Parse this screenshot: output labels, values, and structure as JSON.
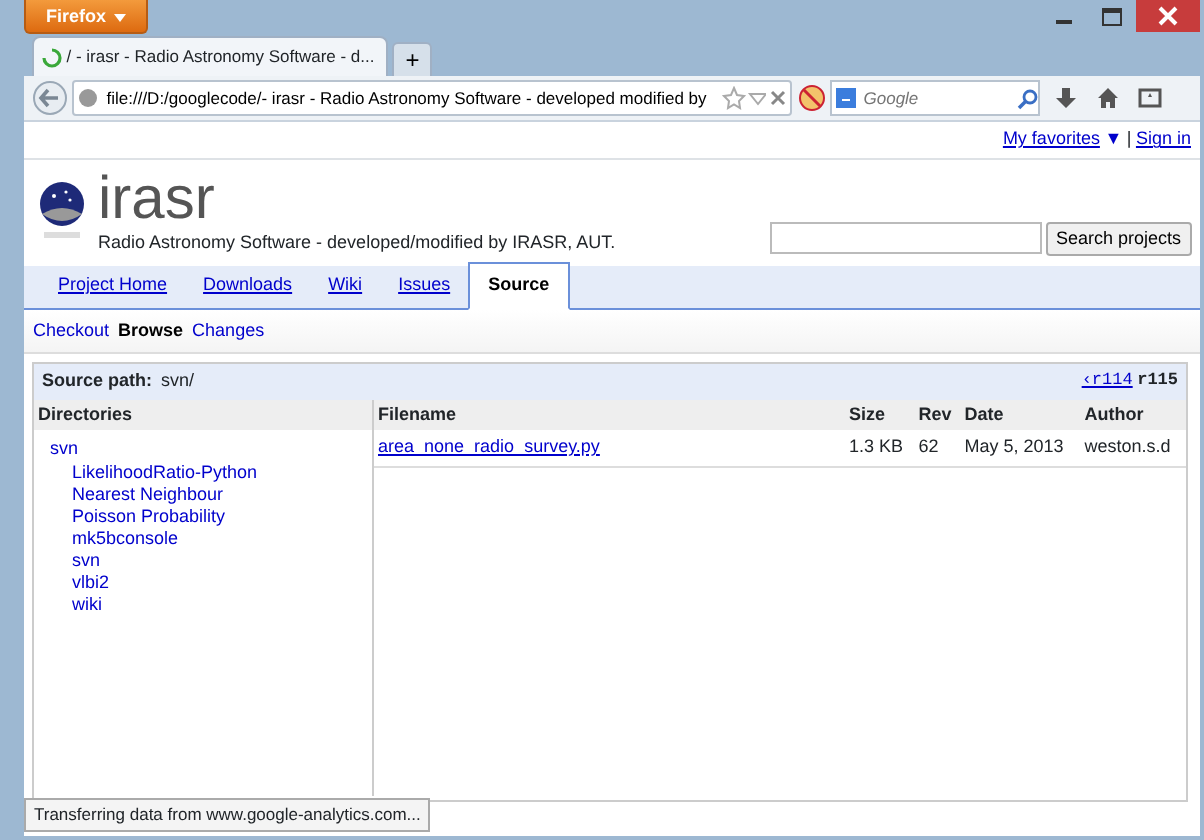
{
  "browser": {
    "menu_button": "Firefox",
    "tabs": [
      {
        "title": "/ - irasr - Radio Astronomy Software - d...",
        "selected": true,
        "loading": true
      }
    ],
    "new_tab": "+",
    "url": "file:///D:/googlecode/- irasr - Radio Astronomy Software - developed modified by",
    "search_placeholder": "Google",
    "status": "Transferring data from www.google-analytics.com..."
  },
  "user_bar": {
    "favorites": "My favorites",
    "caret": "▼",
    "separator": "|",
    "sign_in": "Sign in"
  },
  "project": {
    "name": "irasr",
    "summary": "Radio Astronomy Software - developed/modified by IRASR, AUT.",
    "search_button": "Search projects"
  },
  "main_tabs": [
    {
      "label": "Project Home",
      "selected": false
    },
    {
      "label": "Downloads",
      "selected": false
    },
    {
      "label": "Wiki",
      "selected": false
    },
    {
      "label": "Issues",
      "selected": false
    },
    {
      "label": "Source",
      "selected": true
    }
  ],
  "sub_tabs": [
    {
      "label": "Checkout",
      "selected": false
    },
    {
      "label": "Browse",
      "selected": true
    },
    {
      "label": "Changes",
      "selected": false
    }
  ],
  "source_path": {
    "label": "Source path:",
    "value": "svn/",
    "prev_rev": "‹r114",
    "current_rev": "r115"
  },
  "directories": {
    "heading": "Directories",
    "tree": [
      {
        "name": "svn",
        "children": [
          {
            "name": "LikelihoodRatio-Python"
          },
          {
            "name": "Nearest Neighbour"
          },
          {
            "name": "Poisson Probability"
          },
          {
            "name": "mk5bconsole"
          },
          {
            "name": "svn"
          },
          {
            "name": "vlbi2"
          },
          {
            "name": "wiki"
          }
        ]
      }
    ]
  },
  "files": {
    "columns": [
      "Filename",
      "Size",
      "Rev",
      "Date",
      "Author"
    ],
    "rows": [
      [
        "area_none_radio_survey.py",
        "1.3 KB",
        "62",
        "May 5, 2013",
        "weston.s.d"
      ]
    ]
  }
}
